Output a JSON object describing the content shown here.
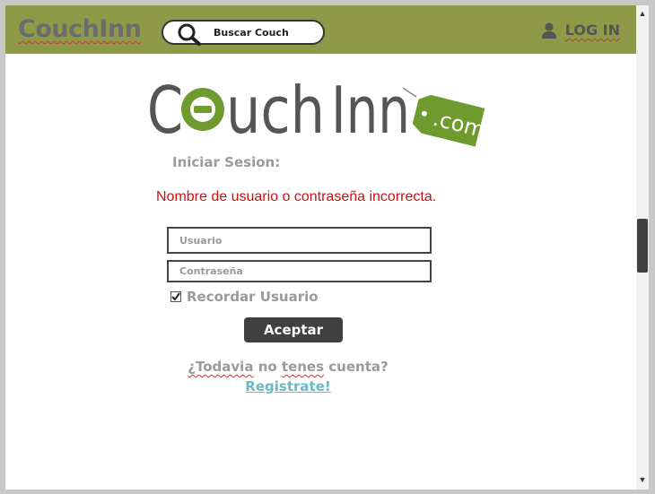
{
  "navbar": {
    "brand": "CouchInn",
    "search_label": "Buscar Couch",
    "login_label": "LOG IN",
    "background": "#8e9a48"
  },
  "logo": {
    "text_main": "Couch Inn",
    "text_tag": ".com",
    "accent": "#6f9a2e"
  },
  "form": {
    "heading": "Iniciar Sesion:",
    "error": "Nombre de usuario o contraseña incorrecta.",
    "username_placeholder": "Usuario",
    "password_placeholder": "Contraseña",
    "remember_label": "Recordar Usuario",
    "remember_checked": true,
    "submit_label": "Aceptar"
  },
  "footer": {
    "no_account_q": "¿Todavia",
    "no_account_mid": "no",
    "no_account_tenes": "tenes",
    "no_account_end": "cuenta?",
    "register_link": "Registrate!"
  },
  "icons": {
    "search": "search-icon",
    "user": "user-icon",
    "check": "check-icon",
    "scroll_up": "arrow-up-icon",
    "scroll_down": "arrow-down-icon"
  }
}
